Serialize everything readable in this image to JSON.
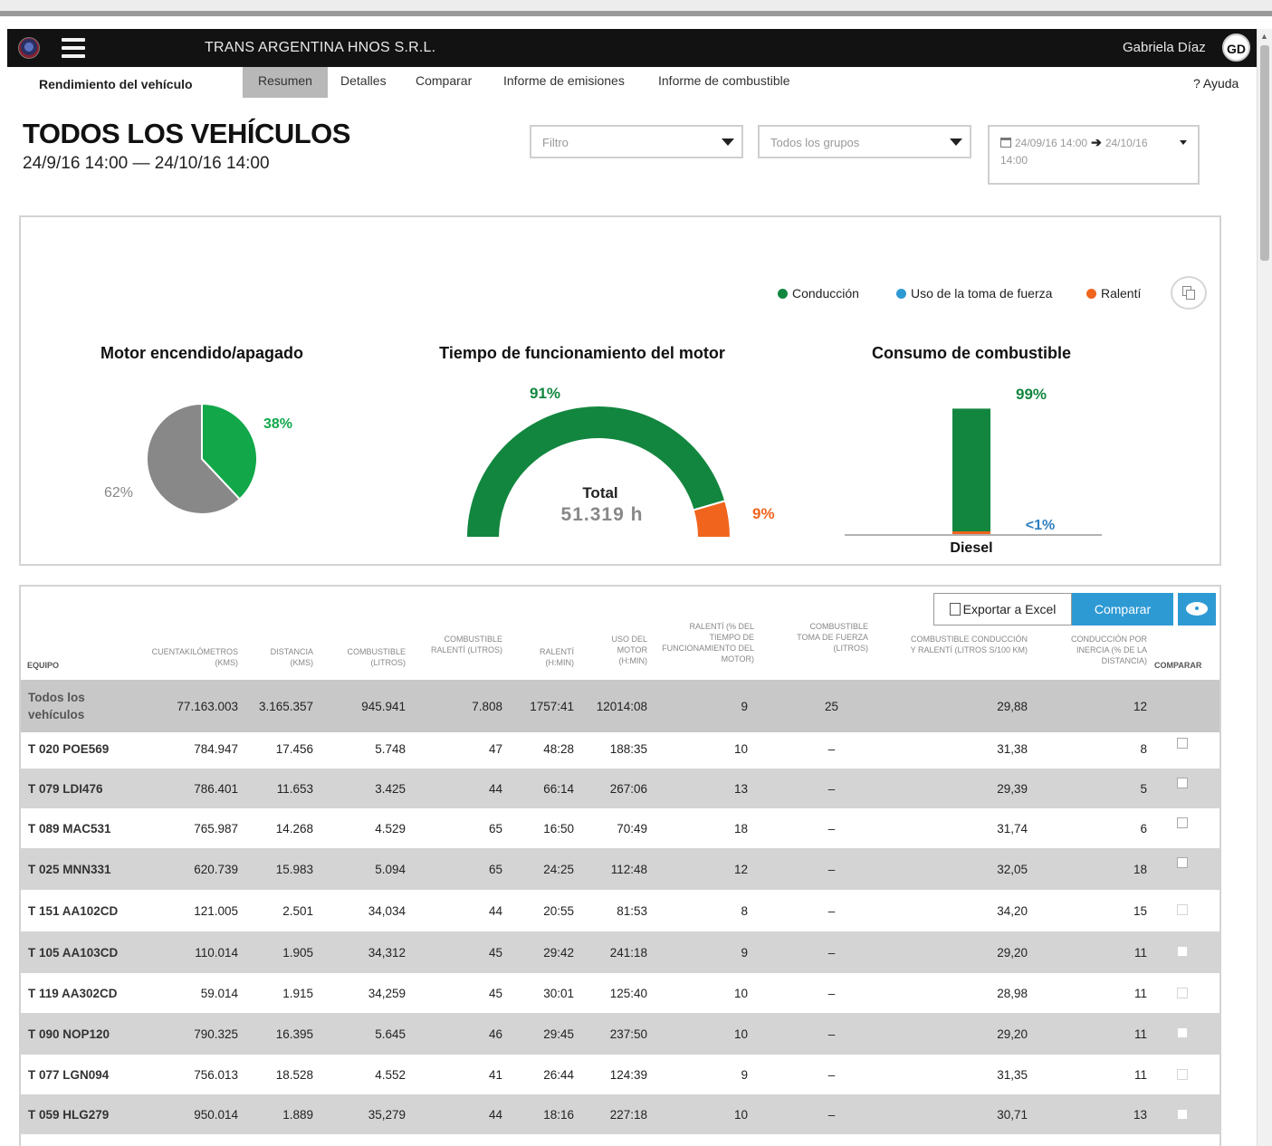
{
  "header": {
    "company": "TRANS ARGENTINA HNOS S.R.L.",
    "user_name": "Gabriela Díaz",
    "avatar_initials": "GD"
  },
  "nav": {
    "section_title": "Rendimiento del vehículo",
    "tabs": [
      "Resumen",
      "Detalles",
      "Comparar",
      "Informe de emisiones",
      "Informe de combustible"
    ],
    "active_tab": "Resumen",
    "help": "? Ayuda"
  },
  "page": {
    "title": "TODOS LOS VEHÍCULOS",
    "date_range": "24/9/16 14:00 — 24/10/16 14:00"
  },
  "filters": {
    "filter_placeholder": "Filtro",
    "group_placeholder": "Todos los grupos",
    "date_from": "24/09/16 14:00",
    "date_to": "24/10/16",
    "date_to_time": "14:00"
  },
  "legend": {
    "items": [
      {
        "label": "Conducción",
        "color": "#12863f"
      },
      {
        "label": "Uso de la toma de fuerza",
        "color": "#2e9ad4"
      },
      {
        "label": "Ralentí",
        "color": "#f0641e"
      }
    ]
  },
  "chart_data": [
    {
      "type": "pie",
      "title": "Motor encendido/apagado",
      "slices": [
        {
          "label": "38%",
          "value": 38,
          "color": "#12a84a"
        },
        {
          "label": "62%",
          "value": 62,
          "color": "#888888"
        }
      ]
    },
    {
      "type": "pie",
      "title": "Tiempo de funcionamiento del motor",
      "center_label": "Total",
      "center_value": "51.319 h",
      "slices": [
        {
          "label": "91%",
          "value": 91,
          "color": "#12863f"
        },
        {
          "label": "9%",
          "value": 9,
          "color": "#f0641e"
        }
      ]
    },
    {
      "type": "bar",
      "title": "Consumo de combustible",
      "categories": [
        "Diesel"
      ],
      "series": [
        {
          "label": "99%",
          "value": 99,
          "color": "#12863f"
        },
        {
          "label": "<1%",
          "value": 1,
          "color": "#f0641e"
        }
      ],
      "ylim": [
        0,
        100
      ]
    }
  ],
  "table": {
    "actions": {
      "export": "Exportar a Excel",
      "compare": "Comparar"
    },
    "headers": [
      "EQUIPO",
      "CUENTAKILÓMETROS (KMS)",
      "DISTANCIA (KMS)",
      "COMBUSTIBLE (LITROS)",
      "COMBUSTIBLE RALENTÍ (LITROS)",
      "RALENTÍ (H:MIN)",
      "USO DEL MOTOR (H:MIN)",
      "RALENTÍ (% DEL TIEMPO DE FUNCIONAMIENTO DEL MOTOR)",
      "COMBUSTIBLE TOMA DE FUERZA (LITROS)",
      "COMBUSTIBLE CONDUCCIÓN Y RALENTÍ (LITROS S/100 KM)",
      "CONDUCCIÓN POR INERCIA (% DE LA DISTANCIA)",
      "COMPARAR"
    ],
    "total_row": [
      "Todos los vehículos",
      "77.163.003",
      "3.165.357",
      "945.941",
      "7.808",
      "1757:41",
      "12014:08",
      "9",
      "25",
      "29,88",
      "12"
    ],
    "rows": [
      [
        "T 020 POE569",
        "784.947",
        "17.456",
        "5.748",
        "47",
        "48:28",
        "188:35",
        "10",
        "–",
        "31,38",
        "8"
      ],
      [
        "T 079 LDI476",
        "786.401",
        "11.653",
        "3.425",
        "44",
        "66:14",
        "267:06",
        "13",
        "–",
        "29,39",
        "5"
      ],
      [
        "T 089 MAC531",
        "765.987",
        "14.268",
        "4.529",
        "65",
        "16:50",
        "70:49",
        "18",
        "–",
        "31,74",
        "6"
      ],
      [
        "T 025 MNN331",
        "620.739",
        "15.983",
        "5.094",
        "65",
        "24:25",
        "112:48",
        "12",
        "–",
        "32,05",
        "18"
      ],
      [
        "T 151 AA102CD",
        "121.005",
        "2.501",
        "34,034",
        "44",
        "20:55",
        "81:53",
        "8",
        "–",
        "34,20",
        "15"
      ],
      [
        "T 105 AA103CD",
        "110.014",
        "1.905",
        "34,312",
        "45",
        "29:42",
        "241:18",
        "9",
        "–",
        "29,20",
        "11"
      ],
      [
        "T 119 AA302CD",
        "59.014",
        "1.915",
        "34,259",
        "45",
        "30:01",
        "125:40",
        "10",
        "–",
        "28,98",
        "11"
      ],
      [
        "T 090 NOP120",
        "790.325",
        "16.395",
        "5.645",
        "46",
        "29:45",
        "237:50",
        "10",
        "–",
        "29,20",
        "11"
      ],
      [
        "T 077 LGN094",
        "756.013",
        "18.528",
        "4.552",
        "41",
        "26:44",
        "124:39",
        "9",
        "–",
        "31,35",
        "11"
      ],
      [
        "T 059 HLG279",
        "950.014",
        "1.889",
        "35,279",
        "44",
        "18:16",
        "227:18",
        "10",
        "–",
        "30,71",
        "13"
      ]
    ]
  }
}
